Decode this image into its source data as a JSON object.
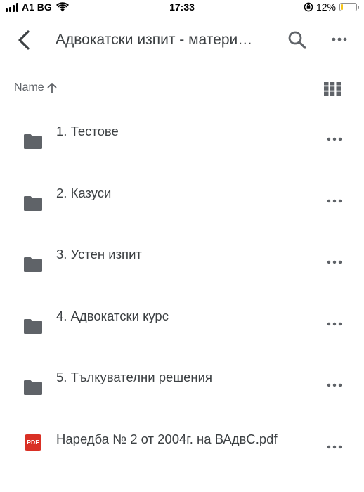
{
  "status_bar": {
    "carrier": "A1 BG",
    "time": "17:33",
    "battery_percent": "12%",
    "battery_level": 0.12,
    "icons": [
      "signal-icon",
      "wifi-icon",
      "orientation-lock-icon",
      "battery-icon"
    ]
  },
  "app_bar": {
    "title": "Адвокатски изпит - матери…",
    "icons": [
      "back-chevron-icon",
      "search-icon",
      "more-horizontal-icon"
    ]
  },
  "sort": {
    "label": "Name",
    "direction": "ascending",
    "icons": [
      "arrow-up-icon",
      "grid-view-icon"
    ]
  },
  "files": [
    {
      "name": "1. Тестове",
      "type": "folder",
      "icon": "folder-icon"
    },
    {
      "name": "2. Казуси",
      "type": "folder",
      "icon": "folder-icon"
    },
    {
      "name": "3. Устен изпит",
      "type": "folder",
      "icon": "folder-icon"
    },
    {
      "name": "4. Адвокатски курс",
      "type": "folder",
      "icon": "folder-icon"
    },
    {
      "name": "5. Тълкувателни решения",
      "type": "folder",
      "icon": "folder-icon"
    },
    {
      "name": "Наредба № 2 от 2004г. на ВАдвС.pdf",
      "type": "pdf",
      "icon": "pdf-icon",
      "badge": "PDF"
    }
  ],
  "colors": {
    "text_primary": "#3c4043",
    "icon_gray": "#5f6368",
    "pdf_red": "#d93025",
    "battery_yellow": "#f5c518"
  }
}
